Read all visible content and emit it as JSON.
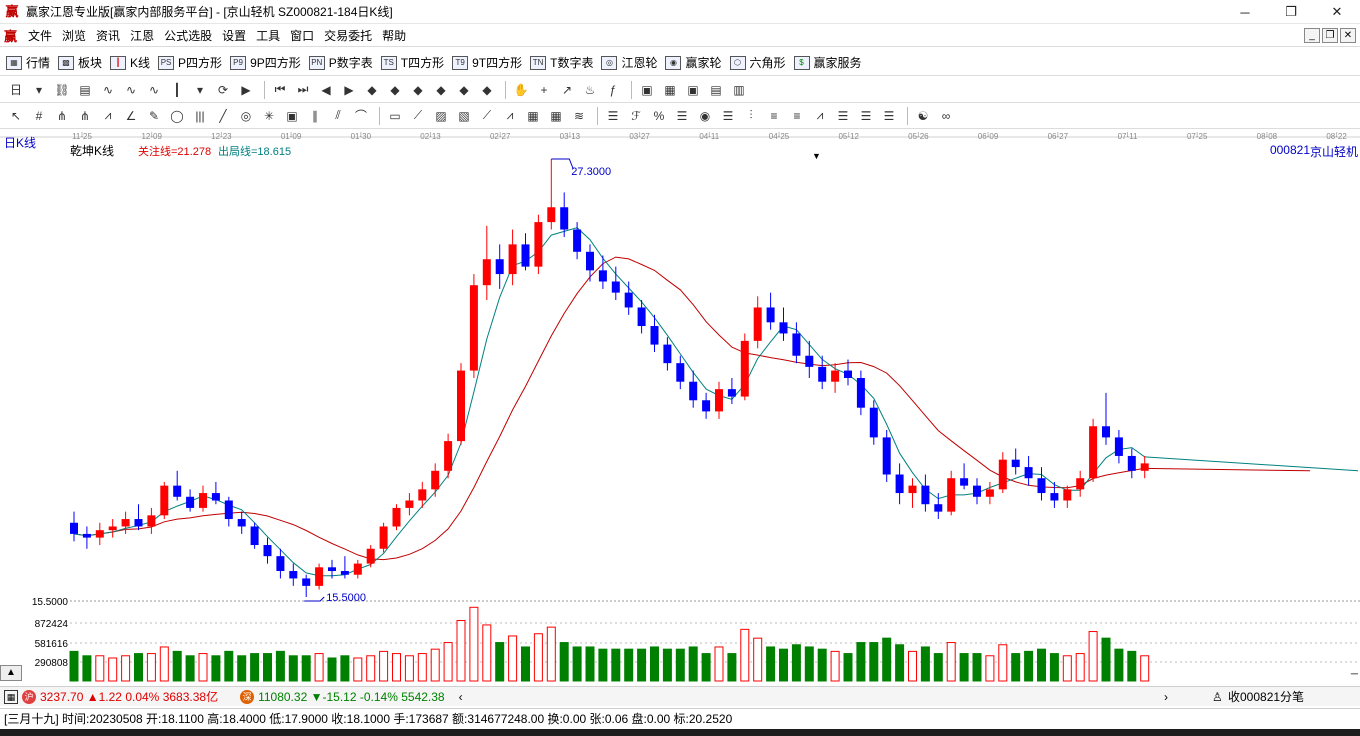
{
  "window": {
    "title": "赢家江恩专业版[赢家内部服务平台] - [京山轻机  SZ000821-184日K线]",
    "minimize": "─",
    "maximize": "❐",
    "close": "✕"
  },
  "menu": {
    "logo": "赢",
    "items": [
      "文件",
      "浏览",
      "资讯",
      "江恩",
      "公式选股",
      "设置",
      "工具",
      "窗口",
      "交易委托",
      "帮助"
    ],
    "mdi": [
      "_",
      "❐",
      "✕"
    ]
  },
  "toolbar1": {
    "items": [
      {
        "icon": "table-icon",
        "glyph": "▦",
        "label": "行情"
      },
      {
        "icon": "blocks-icon",
        "glyph": "▩",
        "label": "板块"
      },
      {
        "icon": "candlestick-icon",
        "glyph": "┃",
        "label": "K线"
      },
      {
        "icon": "ps-icon",
        "glyph": "PS",
        "label": "P四方形"
      },
      {
        "icon": "p9-icon",
        "glyph": "P9",
        "label": "9P四方形"
      },
      {
        "icon": "pn-icon",
        "glyph": "PN",
        "label": "P数字表"
      },
      {
        "icon": "ts-icon",
        "glyph": "TS",
        "label": "T四方形"
      },
      {
        "icon": "t9-icon",
        "glyph": "T9",
        "label": "9T四方形"
      },
      {
        "icon": "tn-icon",
        "glyph": "TN",
        "label": "T数字表"
      },
      {
        "icon": "gann-wheel-icon",
        "glyph": "◎",
        "label": "江恩轮"
      },
      {
        "icon": "winner-wheel-icon",
        "glyph": "◉",
        "label": "赢家轮"
      },
      {
        "icon": "hexagon-icon",
        "glyph": "⬡",
        "label": "六角形"
      },
      {
        "icon": "dollar-icon",
        "glyph": "$",
        "label": "赢家服务"
      }
    ]
  },
  "chart": {
    "period_label": "日K线",
    "indicator_name": "乾坤K线",
    "focus_line_label": "关注线=21.278",
    "exit_line_label": "出局线=18.615",
    "stock_code": "000821",
    "stock_name": "京山轻机",
    "high_label": "27.3000",
    "low_label": "15.5000",
    "date_ticks": [
      "11-25",
      "12-09",
      "12-23",
      "01-09",
      "01-30",
      "02-13",
      "02-27",
      "03-13",
      "03-27",
      "04-11",
      "04-25",
      "05-12",
      "05-26",
      "06-09",
      "06-27",
      "07-11",
      "07-25",
      "08-08",
      "08-22"
    ],
    "volume_axis": [
      "15.5000",
      "872424",
      "581616",
      "290808"
    ],
    "colors": {
      "up": "#ff0000",
      "down": "#0000ff",
      "neutral": "#800080",
      "ma_fast": "#008080",
      "ma_slow": "#c00000",
      "volume": "#008000"
    }
  },
  "status1": {
    "sh_index": "3237.70",
    "sh_change": "▲1.22",
    "sh_pct": "0.04%",
    "sh_amount": "3683.38亿",
    "sz_index": "11080.32",
    "sz_change": "▼-15.12",
    "sz_pct": "-0.14%",
    "sz_amount": "5542.38",
    "right_label": "收000821分笔"
  },
  "status2": {
    "info": "[三月十九] 时间:20230508 开:18.1100 高:18.4000 低:17.9000 收:18.1000 手:173687 额:314677248.00 换:0.00 张:0.06 盘:0.00 标:20.2520"
  },
  "chart_data": {
    "type": "candlestick",
    "title": "京山轻机 000821 日K线",
    "y_range": [
      15.5,
      27.3
    ],
    "ohlc": [
      [
        17.5,
        17.8,
        17.0,
        17.2
      ],
      [
        17.2,
        17.4,
        16.8,
        17.1
      ],
      [
        17.1,
        17.5,
        16.9,
        17.3
      ],
      [
        17.3,
        17.6,
        17.1,
        17.4
      ],
      [
        17.4,
        17.8,
        17.2,
        17.6
      ],
      [
        17.6,
        18.0,
        17.3,
        17.4
      ],
      [
        17.4,
        17.9,
        17.2,
        17.7
      ],
      [
        17.7,
        18.6,
        17.6,
        18.5
      ],
      [
        18.5,
        18.9,
        18.1,
        18.2
      ],
      [
        18.2,
        18.4,
        17.8,
        17.9
      ],
      [
        17.9,
        18.5,
        17.8,
        18.3
      ],
      [
        18.3,
        18.6,
        18.0,
        18.1
      ],
      [
        18.1,
        18.2,
        17.4,
        17.6
      ],
      [
        17.6,
        17.8,
        17.2,
        17.4
      ],
      [
        17.4,
        17.5,
        16.8,
        16.9
      ],
      [
        16.9,
        17.1,
        16.4,
        16.6
      ],
      [
        16.6,
        16.8,
        16.0,
        16.2
      ],
      [
        16.2,
        16.4,
        15.8,
        16.0
      ],
      [
        16.0,
        16.1,
        15.5,
        15.8
      ],
      [
        15.8,
        16.4,
        15.7,
        16.3
      ],
      [
        16.3,
        16.5,
        16.0,
        16.2
      ],
      [
        16.2,
        16.6,
        16.0,
        16.1
      ],
      [
        16.1,
        16.5,
        16.0,
        16.4
      ],
      [
        16.4,
        16.9,
        16.3,
        16.8
      ],
      [
        16.8,
        17.5,
        16.7,
        17.4
      ],
      [
        17.4,
        18.0,
        17.3,
        17.9
      ],
      [
        17.9,
        18.3,
        17.7,
        18.1
      ],
      [
        18.1,
        18.6,
        17.9,
        18.4
      ],
      [
        18.4,
        19.1,
        18.2,
        18.9
      ],
      [
        18.9,
        19.9,
        18.7,
        19.7
      ],
      [
        19.7,
        21.8,
        19.6,
        21.6
      ],
      [
        21.6,
        24.2,
        21.4,
        23.9
      ],
      [
        23.9,
        25.5,
        23.5,
        24.6
      ],
      [
        24.6,
        25.0,
        23.8,
        24.2
      ],
      [
        24.2,
        25.4,
        23.9,
        25.0
      ],
      [
        25.0,
        25.3,
        24.3,
        24.4
      ],
      [
        24.4,
        25.8,
        24.2,
        25.6
      ],
      [
        25.6,
        27.3,
        25.4,
        26.0
      ],
      [
        26.0,
        26.4,
        25.2,
        25.4
      ],
      [
        25.4,
        25.6,
        24.6,
        24.8
      ],
      [
        24.8,
        25.0,
        24.0,
        24.3
      ],
      [
        24.3,
        24.7,
        23.8,
        24.0
      ],
      [
        24.0,
        24.4,
        23.5,
        23.7
      ],
      [
        23.7,
        24.0,
        23.1,
        23.3
      ],
      [
        23.3,
        23.5,
        22.6,
        22.8
      ],
      [
        22.8,
        23.1,
        22.1,
        22.3
      ],
      [
        22.3,
        22.5,
        21.6,
        21.8
      ],
      [
        21.8,
        22.0,
        21.1,
        21.3
      ],
      [
        21.3,
        21.6,
        20.6,
        20.8
      ],
      [
        20.8,
        21.0,
        20.3,
        20.5
      ],
      [
        20.5,
        21.3,
        20.3,
        21.1
      ],
      [
        21.1,
        21.4,
        20.7,
        20.9
      ],
      [
        20.9,
        22.6,
        20.8,
        22.4
      ],
      [
        22.4,
        23.6,
        22.2,
        23.3
      ],
      [
        23.3,
        23.7,
        22.7,
        22.9
      ],
      [
        22.9,
        23.3,
        22.4,
        22.6
      ],
      [
        22.6,
        22.9,
        21.8,
        22.0
      ],
      [
        22.0,
        22.4,
        21.4,
        21.7
      ],
      [
        21.7,
        22.0,
        21.1,
        21.3
      ],
      [
        21.3,
        21.8,
        21.0,
        21.6
      ],
      [
        21.6,
        21.9,
        21.2,
        21.4
      ],
      [
        21.4,
        21.6,
        20.4,
        20.6
      ],
      [
        20.6,
        20.8,
        19.6,
        19.8
      ],
      [
        19.8,
        20.0,
        18.6,
        18.8
      ],
      [
        18.8,
        19.1,
        18.0,
        18.3
      ],
      [
        18.3,
        18.7,
        17.9,
        18.5
      ],
      [
        18.5,
        18.8,
        17.8,
        18.0
      ],
      [
        18.0,
        18.3,
        17.6,
        17.8
      ],
      [
        17.8,
        18.9,
        17.7,
        18.7
      ],
      [
        18.7,
        19.1,
        18.4,
        18.5
      ],
      [
        18.5,
        18.7,
        18.0,
        18.2
      ],
      [
        18.2,
        18.6,
        18.0,
        18.4
      ],
      [
        18.4,
        19.4,
        18.3,
        19.2
      ],
      [
        19.2,
        19.5,
        18.8,
        19.0
      ],
      [
        19.0,
        19.3,
        18.5,
        18.7
      ],
      [
        18.7,
        19.0,
        18.1,
        18.3
      ],
      [
        18.3,
        18.6,
        17.9,
        18.1
      ],
      [
        18.1,
        18.5,
        17.9,
        18.4
      ],
      [
        18.4,
        18.9,
        18.2,
        18.7
      ],
      [
        18.7,
        20.3,
        18.6,
        20.1
      ],
      [
        20.1,
        21.0,
        19.6,
        19.8
      ],
      [
        19.8,
        20.0,
        19.1,
        19.3
      ],
      [
        19.3,
        19.5,
        18.7,
        18.9
      ],
      [
        18.9,
        19.3,
        18.7,
        19.1
      ]
    ]
  }
}
